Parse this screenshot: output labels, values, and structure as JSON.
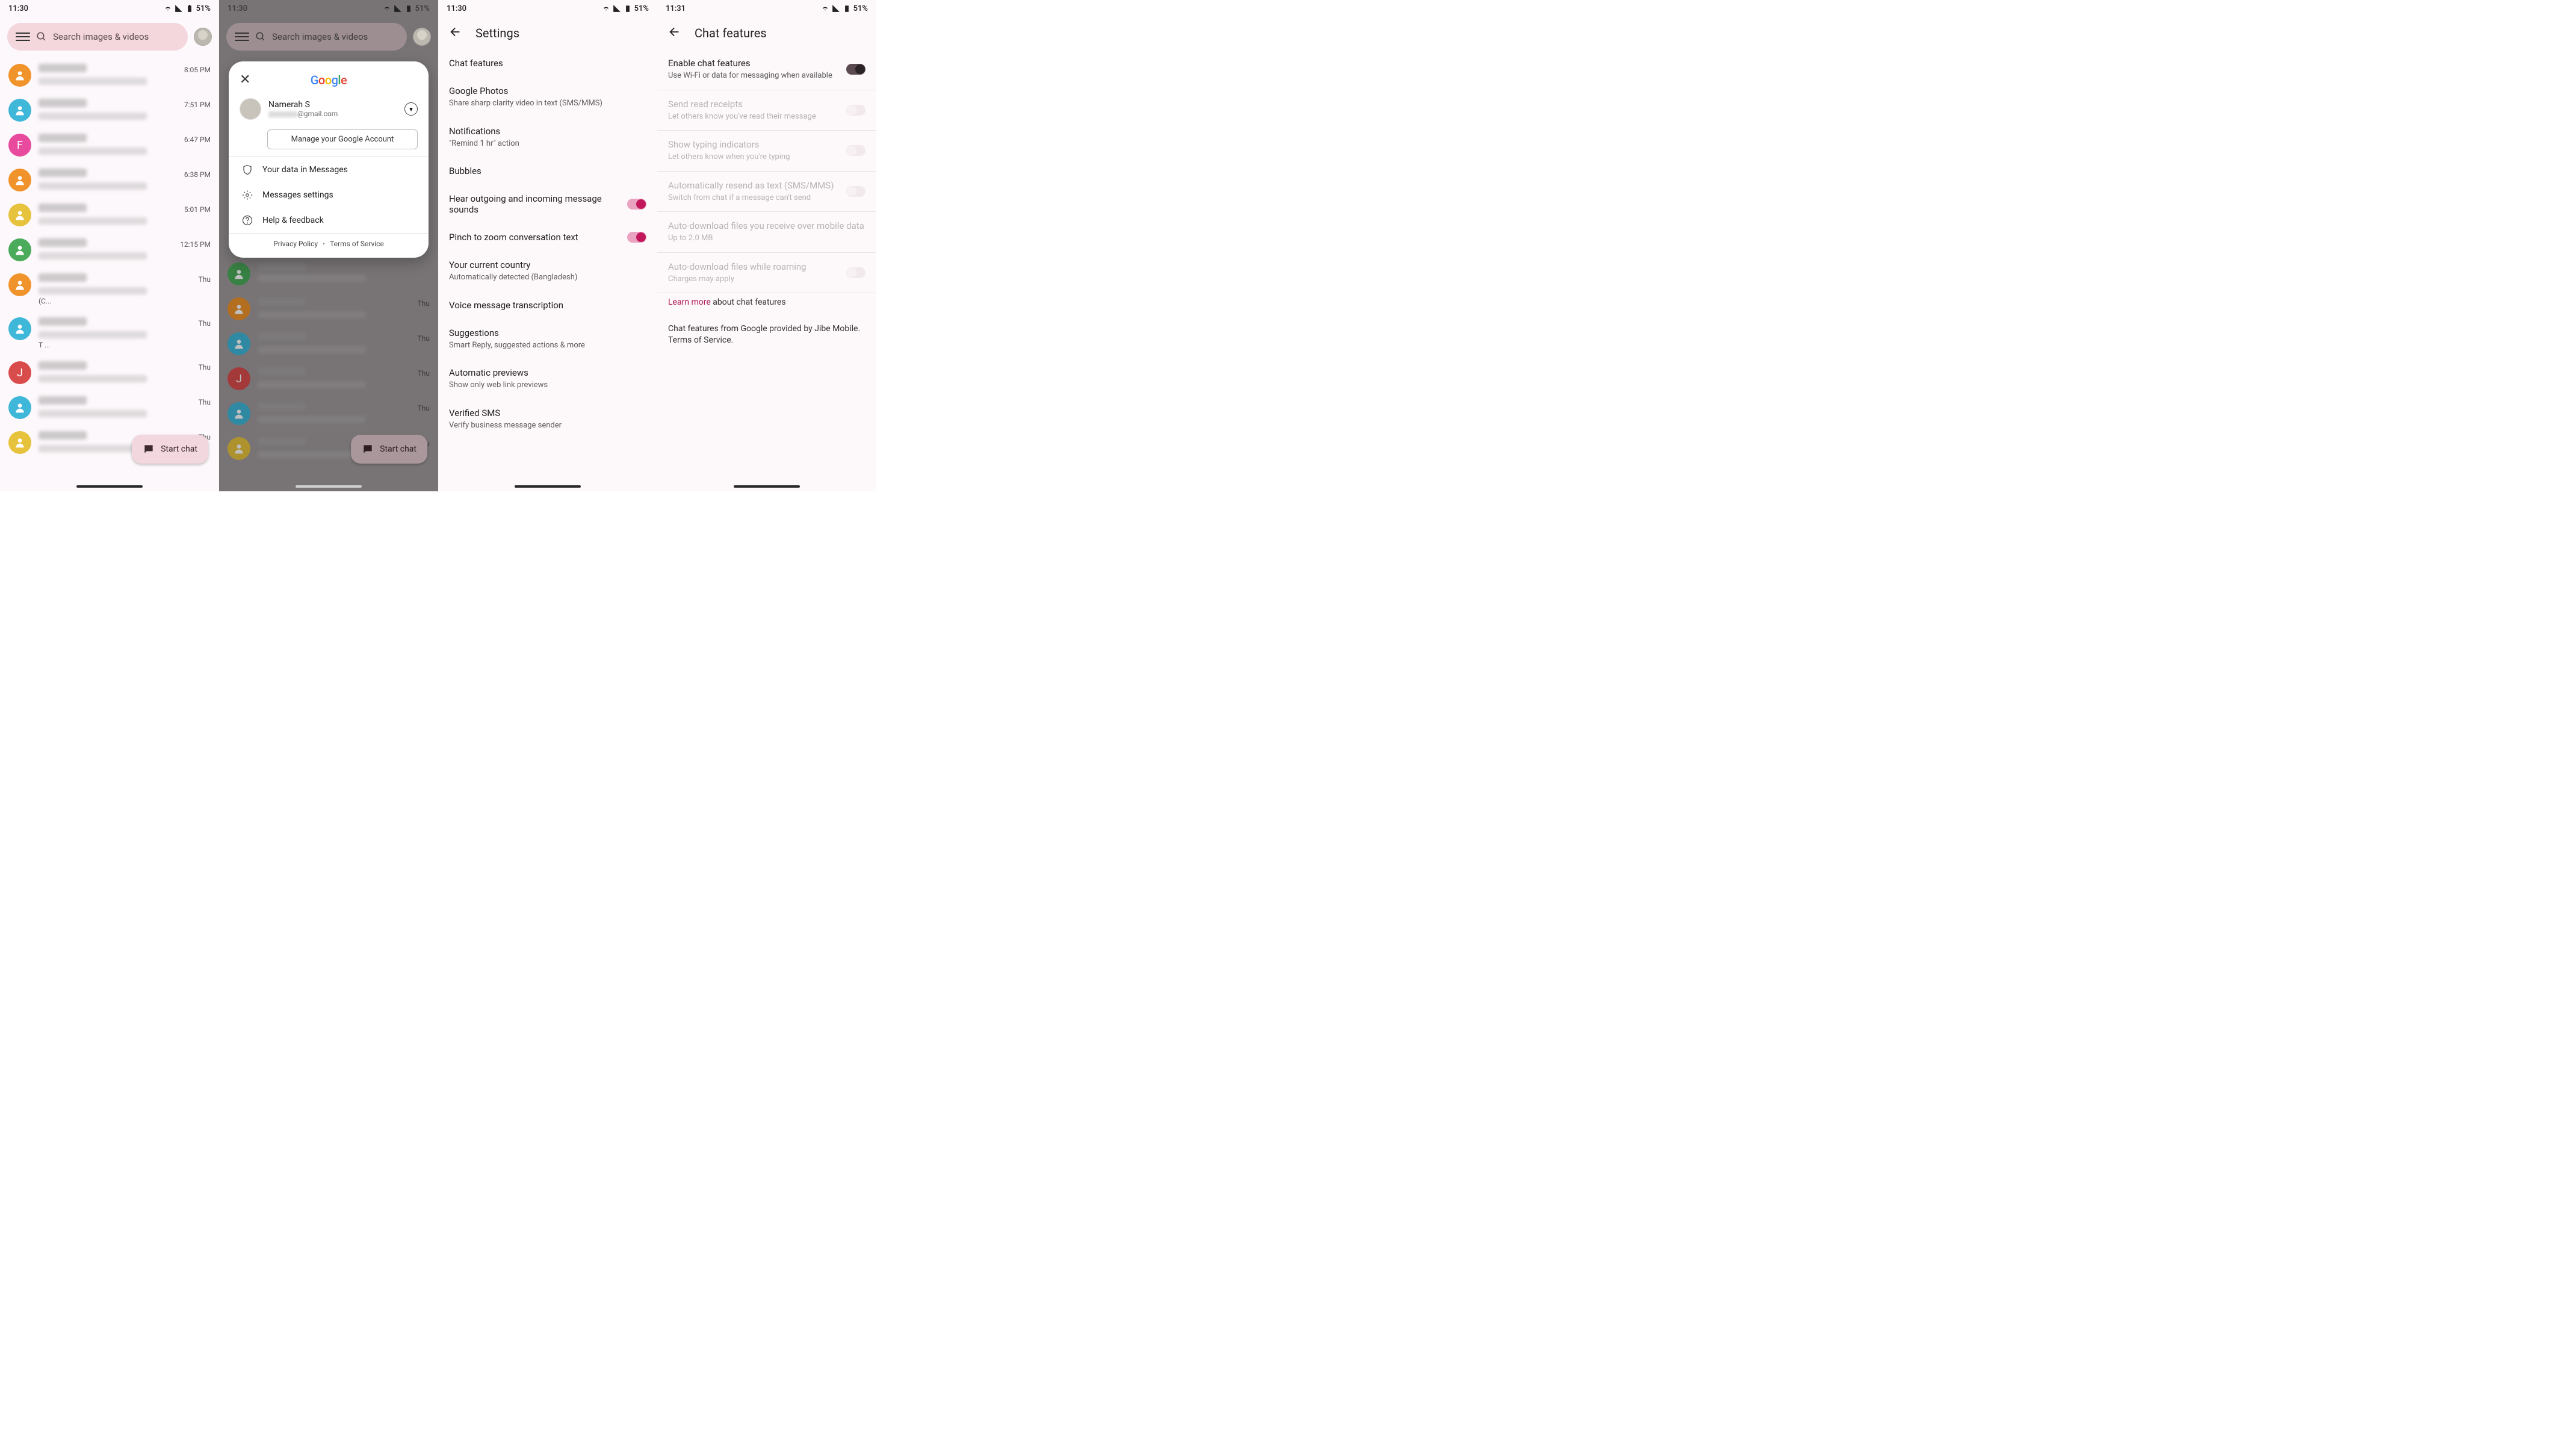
{
  "status": {
    "time1": "11:30",
    "time2": "11:31",
    "battery": "51%"
  },
  "search": {
    "placeholder": "Search images & videos"
  },
  "fab": {
    "label": "Start chat"
  },
  "conversations": [
    {
      "color": "#f0932b",
      "letter": "",
      "time": "8:05 PM",
      "tail": ""
    },
    {
      "color": "#3fb7d8",
      "letter": "",
      "time": "7:51 PM",
      "tail": ""
    },
    {
      "color": "#e84a9e",
      "letter": "F",
      "time": "6:47 PM",
      "tail": ""
    },
    {
      "color": "#f0932b",
      "letter": "",
      "time": "6:38 PM",
      "tail": ""
    },
    {
      "color": "#e7c23c",
      "letter": "",
      "time": "5:01 PM",
      "tail": ""
    },
    {
      "color": "#4aac5b",
      "letter": "",
      "time": "12:15 PM",
      "tail": ""
    },
    {
      "color": "#f0932b",
      "letter": "",
      "time": "Thu",
      "tail": "(C..."
    },
    {
      "color": "#3fb7d8",
      "letter": "",
      "time": "Thu",
      "tail": "T ..."
    },
    {
      "color": "#d94c4c",
      "letter": "J",
      "time": "Thu",
      "tail": ""
    },
    {
      "color": "#3fb7d8",
      "letter": "",
      "time": "Thu",
      "tail": ""
    },
    {
      "color": "#e7c23c",
      "letter": "",
      "time": "Thu",
      "tail": ""
    }
  ],
  "dimConversations": [
    {
      "color": "#4aac5b",
      "time": ""
    },
    {
      "color": "#f0932b",
      "time": "Thu"
    },
    {
      "color": "#3fb7d8",
      "time": "Thu"
    },
    {
      "color": "#d94c4c",
      "letter": "J",
      "time": "Thu"
    },
    {
      "color": "#3fb7d8",
      "time": "Thu"
    },
    {
      "color": "#e7c23c",
      "time": "Thu"
    }
  ],
  "account": {
    "name": "Namerah S",
    "emailSuffix": "@gmail.com",
    "manage": "Manage your Google Account",
    "items": {
      "data": "Your data in Messages",
      "settings": "Messages settings",
      "help": "Help & feedback"
    },
    "privacy": "Privacy Policy",
    "terms": "Terms of Service"
  },
  "settings": {
    "title": "Settings",
    "items": [
      {
        "title": "Chat features",
        "sub": ""
      },
      {
        "title": "Google Photos",
        "sub": "Share sharp clarity video in text (SMS/MMS)"
      },
      {
        "title": "Notifications",
        "sub": "\"Remind 1 hr\" action"
      },
      {
        "title": "Bubbles",
        "sub": ""
      },
      {
        "title": "Hear outgoing and incoming message sounds",
        "sub": "",
        "toggle": "on"
      },
      {
        "title": "Pinch to zoom conversation text",
        "sub": "",
        "toggle": "on"
      },
      {
        "title": "Your current country",
        "sub": "Automatically detected (Bangladesh)"
      },
      {
        "title": "Voice message transcription",
        "sub": ""
      },
      {
        "title": "Suggestions",
        "sub": "Smart Reply, suggested actions & more"
      },
      {
        "title": "Automatic previews",
        "sub": "Show only web link previews"
      },
      {
        "title": "Verified SMS",
        "sub": "Verify business message sender"
      }
    ]
  },
  "chatFeatures": {
    "title": "Chat features",
    "items": [
      {
        "title": "Enable chat features",
        "sub": "Use Wi-Fi or data for messaging when available",
        "toggle": "dark",
        "enabled": true
      },
      {
        "title": "Send read receipts",
        "sub": "Let others know you've read their message",
        "toggle": "offdis",
        "enabled": false
      },
      {
        "title": "Show typing indicators",
        "sub": "Let others know when you're typing",
        "toggle": "offdis",
        "enabled": false
      },
      {
        "title": "Automatically resend as text (SMS/MMS)",
        "sub": "Switch from chat if a message can't send",
        "toggle": "offdis",
        "enabled": false
      },
      {
        "title": "Auto-download files you receive over mobile data",
        "sub": "Up to 2.0 MB",
        "enabled": false
      },
      {
        "title": "Auto-download files while roaming",
        "sub": "Charges may apply",
        "toggle": "offdis",
        "enabled": false
      }
    ],
    "learnMore": "Learn more",
    "learnMoreTail": " about chat features",
    "provider": "Chat features from Google provided by Jibe Mobile. Terms of Service."
  }
}
